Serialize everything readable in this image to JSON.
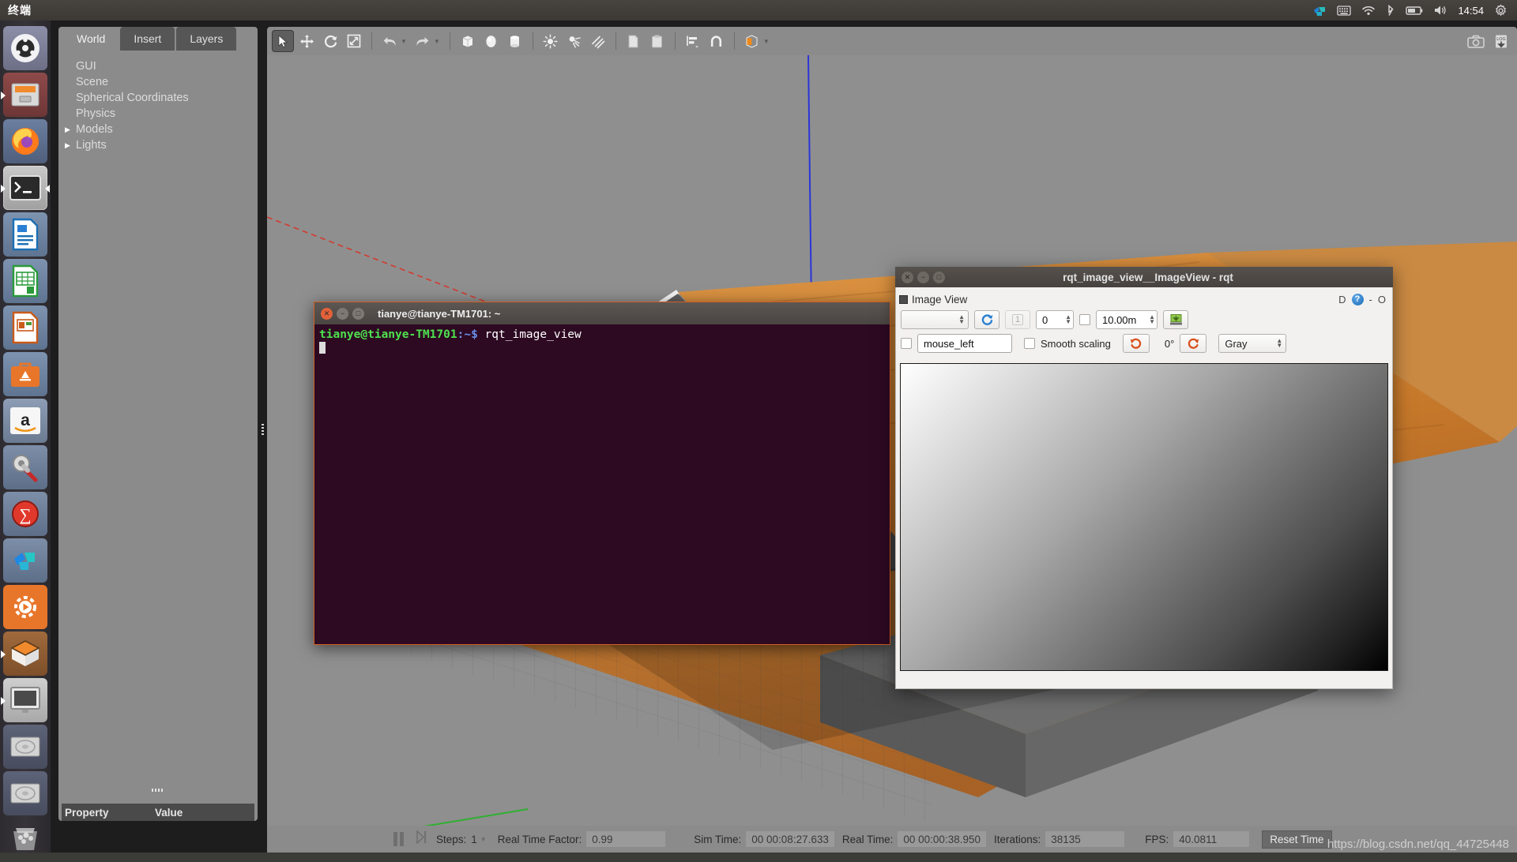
{
  "desktop": {
    "active_app_name": "终端",
    "clock": "14:54",
    "tray_icons": [
      "app-indicator-icon",
      "keyboard-icon",
      "wifi-icon",
      "bluetooth-icon",
      "battery-icon",
      "volume-icon"
    ],
    "gear_icon": "gear-icon",
    "launcher_items": [
      {
        "name": "ubuntu-dash",
        "label": "Dash"
      },
      {
        "name": "files",
        "label": "Files"
      },
      {
        "name": "firefox",
        "label": "Firefox"
      },
      {
        "name": "terminal",
        "label": "Terminal"
      },
      {
        "name": "libreoffice-writer",
        "label": "LibreOffice Writer"
      },
      {
        "name": "libreoffice-calc",
        "label": "LibreOffice Calc"
      },
      {
        "name": "libreoffice-impress",
        "label": "LibreOffice Impress"
      },
      {
        "name": "ubuntu-software",
        "label": "Ubuntu Software"
      },
      {
        "name": "amazon",
        "label": "Amazon"
      },
      {
        "name": "system-settings",
        "label": "System Settings"
      },
      {
        "name": "red-app",
        "label": "Application"
      },
      {
        "name": "teal-app",
        "label": "Application"
      },
      {
        "name": "media-player",
        "label": "Media Player"
      },
      {
        "name": "gazebo",
        "label": "Gazebo"
      },
      {
        "name": "display-app",
        "label": "Display"
      },
      {
        "name": "disk-1",
        "label": "Disk"
      },
      {
        "name": "disk-2",
        "label": "Disk"
      },
      {
        "name": "trash",
        "label": "Trash"
      }
    ]
  },
  "gazebo": {
    "tabs": [
      {
        "label": "World",
        "active": true
      },
      {
        "label": "Insert",
        "active": false
      },
      {
        "label": "Layers",
        "active": false
      }
    ],
    "tree": [
      {
        "label": "GUI",
        "expandable": false
      },
      {
        "label": "Scene",
        "expandable": false
      },
      {
        "label": "Spherical Coordinates",
        "expandable": false
      },
      {
        "label": "Physics",
        "expandable": false
      },
      {
        "label": "Models",
        "expandable": true
      },
      {
        "label": "Lights",
        "expandable": true
      }
    ],
    "property_header": {
      "property": "Property",
      "value": "Value"
    },
    "toolbar": [
      {
        "name": "select-tool-icon",
        "active": true
      },
      {
        "name": "translate-tool-icon",
        "active": false
      },
      {
        "name": "rotate-tool-icon",
        "active": false
      },
      {
        "name": "scale-tool-icon",
        "active": false
      },
      {
        "name": "undo-icon",
        "active": false
      },
      {
        "name": "redo-icon",
        "active": false
      },
      {
        "name": "insert-box-icon",
        "active": false
      },
      {
        "name": "insert-sphere-icon",
        "active": false
      },
      {
        "name": "insert-cylinder-icon",
        "active": false
      },
      {
        "name": "point-light-icon",
        "active": false
      },
      {
        "name": "spot-light-icon",
        "active": false
      },
      {
        "name": "directional-light-icon",
        "active": false
      },
      {
        "name": "copy-icon",
        "active": false
      },
      {
        "name": "paste-icon",
        "active": false
      },
      {
        "name": "align-icon",
        "active": false
      },
      {
        "name": "snap-icon",
        "active": false
      },
      {
        "name": "view-angle-icon",
        "active": false
      }
    ],
    "toolbar_right": [
      "screenshot-icon",
      "log-record-icon"
    ],
    "status": {
      "pause_icon": "pause-icon",
      "step_icon": "step-forward-icon",
      "steps_label": "Steps:",
      "steps_value": "1",
      "rtf_label": "Real Time Factor:",
      "rtf_value": "0.99",
      "sim_time_label": "Sim Time:",
      "sim_time_value": "00 00:08:27.633",
      "real_time_label": "Real Time:",
      "real_time_value": "00 00:00:38.950",
      "iterations_label": "Iterations:",
      "iterations_value": "38135",
      "fps_label": "FPS:",
      "fps_value": "40.0811",
      "reset_button": "Reset Time"
    }
  },
  "terminal": {
    "title": "tianye@tianye-TM1701: ~",
    "prompt_user": "tianye@tianye-TM1701",
    "prompt_path": ":~$",
    "command": "rqt_image_view"
  },
  "rqt": {
    "window_title": "rqt_image_view__ImageView - rqt",
    "dock": {
      "title": "Image View",
      "controls": [
        "D",
        "?",
        "-",
        "O"
      ]
    },
    "toolbar_row1": {
      "topic_combo_value": "",
      "refresh_icon": "refresh-icon",
      "publish_btn_label": "1",
      "index_spin_value": "0",
      "dynamic_range_checked": false,
      "max_range_value": "10.00m",
      "save_icon": "save-image-icon"
    },
    "toolbar_row2": {
      "mouse_pub_checked": false,
      "mouse_topic_value": "mouse_left",
      "smooth_scaling_label": "Smooth scaling",
      "smooth_scaling_checked": false,
      "rotate_left_icon": "rotate-left-icon",
      "rotation_value": "0°",
      "rotate_right_icon": "rotate-right-icon",
      "colormap_value": "Gray"
    }
  },
  "watermark": "https://blog.csdn.net/qq_44725448"
}
